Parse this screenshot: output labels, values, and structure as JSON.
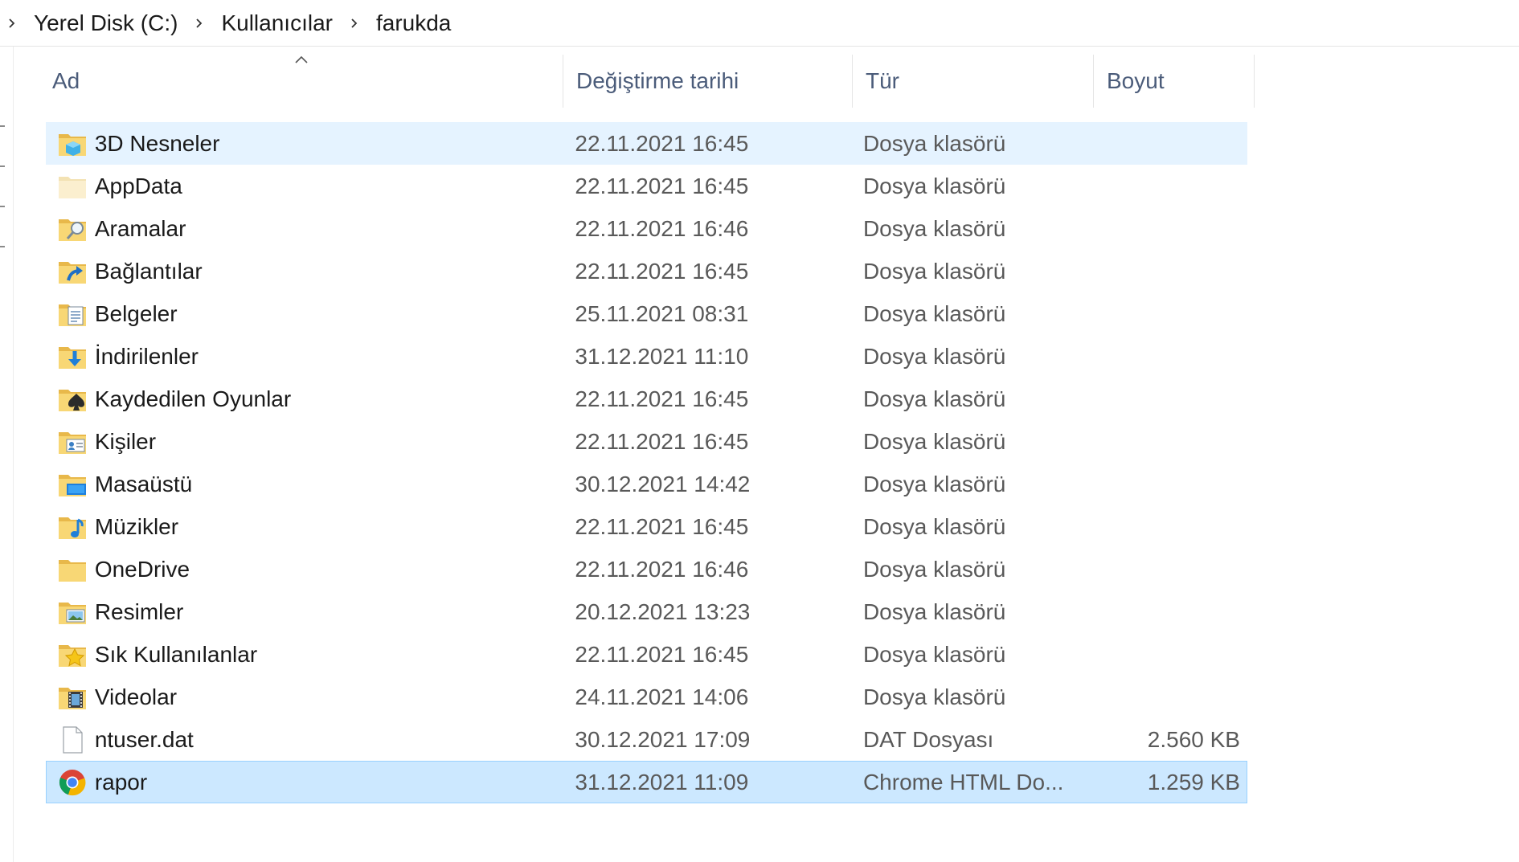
{
  "breadcrumb": {
    "items": [
      "Yerel Disk (C:)",
      "Kullanıcılar",
      "farukda"
    ]
  },
  "columns": {
    "name": "Ad",
    "date": "Değiştirme tarihi",
    "type": "Tür",
    "size": "Boyut"
  },
  "files": [
    {
      "name": "3D Nesneler",
      "date": "22.11.2021 16:45",
      "type": "Dosya klasörü",
      "size": "",
      "icon": "folder-3d-icon",
      "state": "hover"
    },
    {
      "name": "AppData",
      "date": "22.11.2021 16:45",
      "type": "Dosya klasörü",
      "size": "",
      "icon": "folder-hidden-icon",
      "state": ""
    },
    {
      "name": "Aramalar",
      "date": "22.11.2021 16:46",
      "type": "Dosya klasörü",
      "size": "",
      "icon": "folder-search-icon",
      "state": ""
    },
    {
      "name": "Bağlantılar",
      "date": "22.11.2021 16:45",
      "type": "Dosya klasörü",
      "size": "",
      "icon": "folder-links-icon",
      "state": ""
    },
    {
      "name": "Belgeler",
      "date": "25.11.2021 08:31",
      "type": "Dosya klasörü",
      "size": "",
      "icon": "folder-documents-icon",
      "state": ""
    },
    {
      "name": "İndirilenler",
      "date": "31.12.2021 11:10",
      "type": "Dosya klasörü",
      "size": "",
      "icon": "folder-downloads-icon",
      "state": ""
    },
    {
      "name": "Kaydedilen Oyunlar",
      "date": "22.11.2021 16:45",
      "type": "Dosya klasörü",
      "size": "",
      "icon": "folder-games-icon",
      "state": ""
    },
    {
      "name": "Kişiler",
      "date": "22.11.2021 16:45",
      "type": "Dosya klasörü",
      "size": "",
      "icon": "folder-contacts-icon",
      "state": ""
    },
    {
      "name": "Masaüstü",
      "date": "30.12.2021 14:42",
      "type": "Dosya klasörü",
      "size": "",
      "icon": "folder-desktop-icon",
      "state": ""
    },
    {
      "name": "Müzikler",
      "date": "22.11.2021 16:45",
      "type": "Dosya klasörü",
      "size": "",
      "icon": "folder-music-icon",
      "state": ""
    },
    {
      "name": "OneDrive",
      "date": "22.11.2021 16:46",
      "type": "Dosya klasörü",
      "size": "",
      "icon": "folder-icon",
      "state": ""
    },
    {
      "name": "Resimler",
      "date": "20.12.2021 13:23",
      "type": "Dosya klasörü",
      "size": "",
      "icon": "folder-pictures-icon",
      "state": ""
    },
    {
      "name": "Sık Kullanılanlar",
      "date": "22.11.2021 16:45",
      "type": "Dosya klasörü",
      "size": "",
      "icon": "folder-favorites-icon",
      "state": ""
    },
    {
      "name": "Videolar",
      "date": "24.11.2021 14:06",
      "type": "Dosya klasörü",
      "size": "",
      "icon": "folder-videos-icon",
      "state": ""
    },
    {
      "name": "ntuser.dat",
      "date": "30.12.2021 17:09",
      "type": "DAT Dosyası",
      "size": "2.560 KB",
      "icon": "file-icon",
      "state": ""
    },
    {
      "name": "rapor",
      "date": "31.12.2021 11:09",
      "type": "Chrome HTML Do...",
      "size": "1.259 KB",
      "icon": "chrome-icon",
      "state": "selected"
    }
  ]
}
